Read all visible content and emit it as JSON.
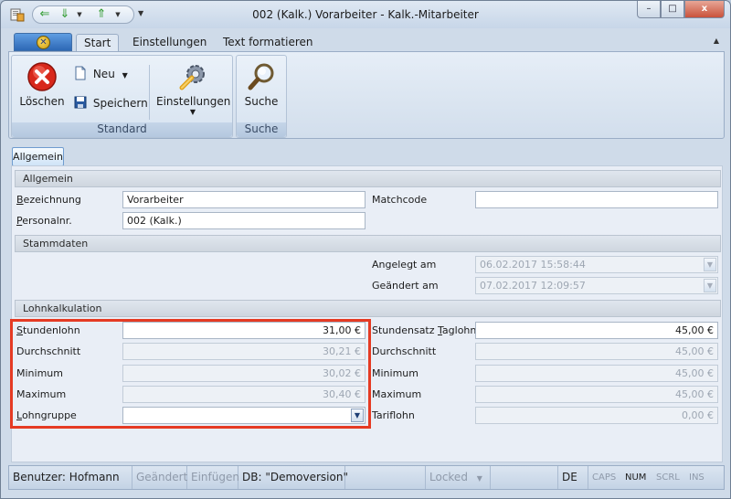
{
  "window": {
    "title": "002 (Kalk.) Vorarbeiter - Kalk.-Mitarbeiter",
    "minimize": "–",
    "maximize": "□",
    "close": "x"
  },
  "ribbon": {
    "tabs": [
      "Start",
      "Einstellungen",
      "Text formatieren"
    ],
    "groups": {
      "standard": {
        "label": "Standard",
        "delete": "Löschen",
        "new": "Neu",
        "save": "Speichern",
        "settings": "Einstellungen"
      },
      "search": {
        "label": "Suche",
        "search": "Suche"
      }
    }
  },
  "page_tab": "Allgemein",
  "sections": {
    "general": {
      "header": "Allgemein",
      "designation_label": "Bezeichnung",
      "designation_value": "Vorarbeiter",
      "personnel_no_label": "Personalnr.",
      "personnel_no_value": "002 (Kalk.)",
      "matchcode_label": "Matchcode",
      "matchcode_value": ""
    },
    "master": {
      "header": "Stammdaten",
      "created_label": "Angelegt am",
      "created_value": "06.02.2017 15:58:44",
      "changed_label": "Geändert am",
      "changed_value": "07.02.2017 12:09:57"
    },
    "wage": {
      "header": "Lohnkalkulation",
      "hourly_label": "Stundenlohn",
      "hourly_value": "31,00 €",
      "avg_label": "Durchschnitt",
      "avg_value": "30,21 €",
      "min_label": "Minimum",
      "min_value": "30,02 €",
      "max_label": "Maximum",
      "max_value": "30,40 €",
      "wage_group_label": "Lohngruppe",
      "wage_group_value": "",
      "day_rate_label": "Stundensatz Taglohn",
      "day_rate_value": "45,00 €",
      "day_avg_label": "Durchschnitt",
      "day_avg_value": "45,00 €",
      "day_min_label": "Minimum",
      "day_min_value": "45,00 €",
      "day_max_label": "Maximum",
      "day_max_value": "45,00 €",
      "tariff_label": "Tariflohn",
      "tariff_value": "0,00 €"
    }
  },
  "statusbar": {
    "user": "Benutzer: Hofmann",
    "changed": "Geändert",
    "insert": "Einfügen",
    "db": "DB: \"Demoversion\"",
    "locked": "Locked",
    "lang": "DE",
    "caps": "CAPS",
    "num": "NUM",
    "scrl": "SCRL",
    "ins": "INS"
  },
  "colors": {
    "highlight": "#e53a23",
    "accent": "#2d68b5"
  }
}
